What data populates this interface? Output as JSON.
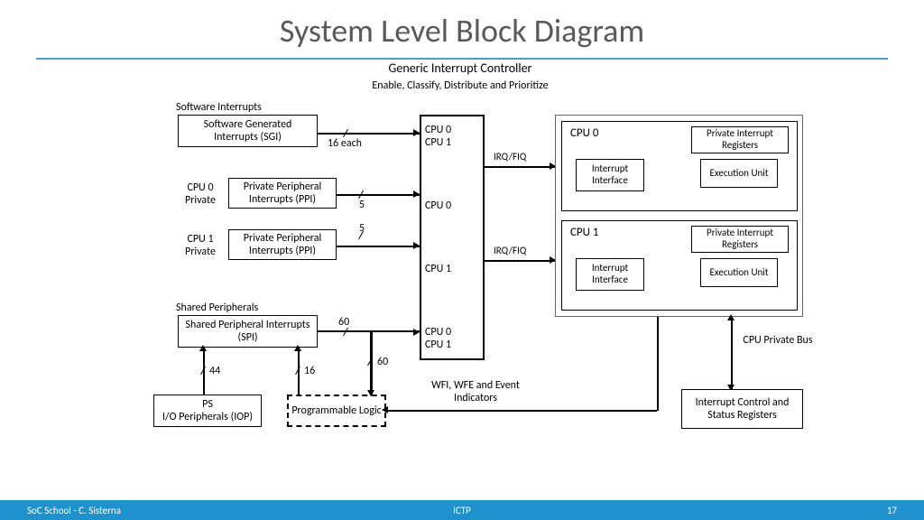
{
  "title": "System Level Block Diagram",
  "gic": {
    "title": "Generic Interrupt Controller",
    "sub": "Enable, Classify, Distribute and Prioritize",
    "rows": [
      "CPU 0",
      "CPU 1",
      "CPU 0",
      "CPU 1",
      "CPU 0",
      "CPU 1"
    ]
  },
  "left": {
    "sgi_lbl": "Software Interrupts",
    "sgi": "Software Generated Interrupts (SGI)",
    "sgi_n": "16 each",
    "cpu0p": "CPU 0 Private",
    "cpu1p": "CPU 1 Private",
    "ppi": "Private Peripheral Interrupts (PPI)",
    "ppi_n": "5",
    "spi_lbl": "Shared Peripherals",
    "spi": "Shared Peripheral Interrupts (SPI)",
    "spi_n": "60",
    "iop": "PS\nI/O Peripherals (IOP)",
    "iop_n": "44",
    "pl": "Programmable Logic",
    "pl_n": "16",
    "pl_n2": "60"
  },
  "sig": {
    "irqfiq": "IRQ/FIQ",
    "wfi": "WFI, WFE and Event Indicators"
  },
  "cpu": {
    "c0": "CPU 0",
    "c1": "CPU 1",
    "ii": "Interrupt Interface",
    "pir": "Private Interrupt Registers",
    "eu": "Execution Unit",
    "bus": "CPU Private Bus",
    "icsr": "Interrupt Control and Status Registers"
  },
  "footer": {
    "l": "SoC School - C. Sisterna",
    "c": "ICTP",
    "r": "17"
  }
}
